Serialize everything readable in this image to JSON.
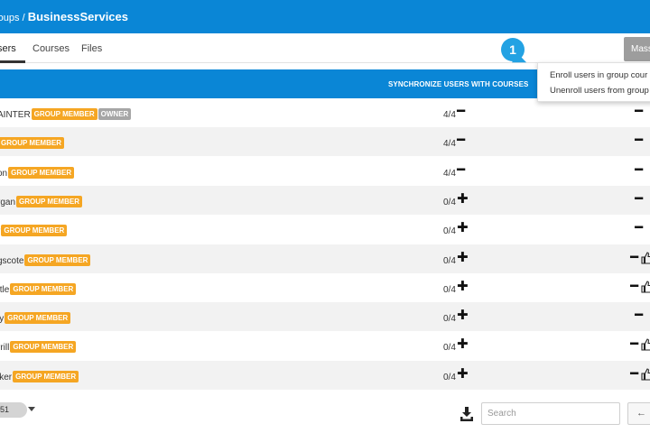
{
  "header": {
    "breadcrumb_parent": "roups /",
    "breadcrumb_current": "BusinessServices"
  },
  "tabs": [
    {
      "label": "sers",
      "active": true
    },
    {
      "label": "Courses",
      "active": false
    },
    {
      "label": "Files",
      "active": false
    }
  ],
  "mass_button_label": "Mass",
  "dropdown": {
    "items": [
      "Enroll users in group cour",
      "Unenroll users from group"
    ]
  },
  "callout_number": "1",
  "table": {
    "column_sync_header": "SYNCHRONIZE USERS WITH COURSES",
    "rows": [
      {
        "name": "AINTER",
        "badges": [
          "GROUP MEMBER",
          "OWNER"
        ],
        "count": "4/4",
        "sync": "minus",
        "remove": true,
        "like": false
      },
      {
        "name": "",
        "badges": [
          "GROUP MEMBER"
        ],
        "count": "4/4",
        "sync": "minus",
        "remove": true,
        "like": false
      },
      {
        "name": "on",
        "badges": [
          "GROUP MEMBER"
        ],
        "count": "4/4",
        "sync": "minus",
        "remove": true,
        "like": false
      },
      {
        "name": "rgan",
        "badges": [
          "GROUP MEMBER"
        ],
        "count": "0/4",
        "sync": "plus",
        "remove": true,
        "like": false
      },
      {
        "name": "r",
        "badges": [
          "GROUP MEMBER"
        ],
        "count": "0/4",
        "sync": "plus",
        "remove": true,
        "like": false
      },
      {
        "name": "gscote",
        "badges": [
          "GROUP MEMBER"
        ],
        "count": "0/4",
        "sync": "plus",
        "remove": true,
        "like": true
      },
      {
        "name": "ttle",
        "badges": [
          "GROUP MEMBER"
        ],
        "count": "0/4",
        "sync": "plus",
        "remove": true,
        "like": true
      },
      {
        "name": "ly",
        "badges": [
          "GROUP MEMBER"
        ],
        "count": "0/4",
        "sync": "plus",
        "remove": true,
        "like": false
      },
      {
        "name": "rrill",
        "badges": [
          "GROUP MEMBER"
        ],
        "count": "0/4",
        "sync": "plus",
        "remove": true,
        "like": true
      },
      {
        "name": "lker",
        "badges": [
          "GROUP MEMBER"
        ],
        "count": "0/4",
        "sync": "plus",
        "remove": true,
        "like": true
      }
    ]
  },
  "footer": {
    "page_size": "51",
    "search_placeholder": "Search",
    "back_label": "←"
  },
  "icons": {
    "sync_add": "plus-icon",
    "sync_remove": "minus-icon",
    "remove": "minus-icon",
    "like": "thumbs-up-icon",
    "download": "download-icon",
    "pager": "caret-down-icon"
  },
  "colors": {
    "primary": "#0a86d6",
    "group_member_badge": "#f5a623",
    "owner_badge": "#a6a6a6",
    "callout": "#23a2e3",
    "mass_button": "#9d9d9d"
  }
}
